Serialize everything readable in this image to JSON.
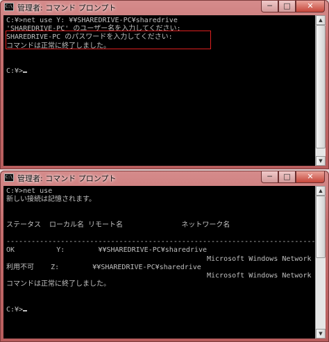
{
  "windows": [
    {
      "title": "管理者: コマンド プロンプト",
      "icon": "console-icon",
      "controls": {
        "minimize": "─",
        "maximize": "□",
        "close": "✕"
      },
      "lines": [
        "C:¥>net use Y: ¥¥SHAREDRIVE-PC¥sharedrive",
        "'SHAREDRIVE-PC' のユーザー名を入力してください:",
        "SHAREDRIVE-PC のパスワードを入力してください:",
        "コマンドは正常に終了しました。",
        "",
        "",
        "C:¥>"
      ]
    },
    {
      "title": "管理者: コマンド プロンプト",
      "icon": "console-icon",
      "controls": {
        "minimize": "─",
        "maximize": "□",
        "close": "✕"
      },
      "lines": [
        "C:¥>net use",
        "新しい接続は記憶されます。",
        "",
        "",
        "ステータス  ローカル名 リモート名              ネットワーク名",
        "",
        "-------------------------------------------------------------------------------",
        "OK          Y:        ¥¥SHAREDRIVE-PC¥sharedrive",
        "                                                Microsoft Windows Network",
        "利用不可    Z:        ¥¥SHAREDRIVE-PC¥sharedrive",
        "                                                Microsoft Windows Network",
        "コマンドは正常に終了しました。",
        "",
        "",
        "C:¥>"
      ]
    }
  ],
  "accent": {
    "highlight_border": "#e02020",
    "titlebar": "#c56f6f"
  }
}
